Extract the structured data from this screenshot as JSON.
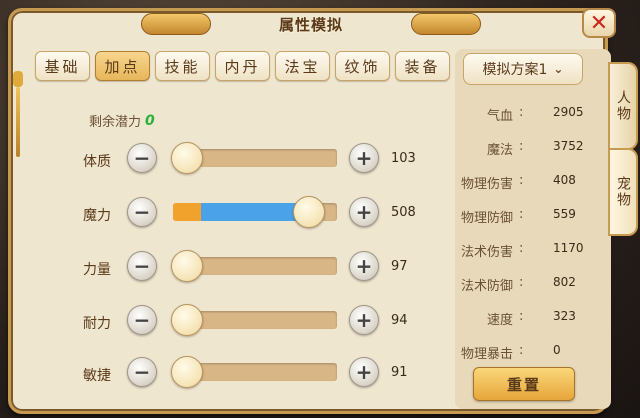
{
  "window": {
    "title": "属性模拟",
    "close_icon": "close-icon"
  },
  "tabs": [
    {
      "label": "基础",
      "active": false
    },
    {
      "label": "加点",
      "active": true
    },
    {
      "label": "技能",
      "active": false
    },
    {
      "label": "内丹",
      "active": false
    },
    {
      "label": "法宝",
      "active": false
    },
    {
      "label": "纹饰",
      "active": false
    },
    {
      "label": "装备",
      "active": false
    }
  ],
  "potential": {
    "label": "剩余潜力",
    "value": "0"
  },
  "attributes": [
    {
      "label": "体质",
      "value": "103",
      "fill_fraction": 0.0
    },
    {
      "label": "魔力",
      "value": "508",
      "fill_fraction": 0.83
    },
    {
      "label": "力量",
      "value": "97",
      "fill_fraction": 0.0
    },
    {
      "label": "耐力",
      "value": "94",
      "fill_fraction": 0.0
    },
    {
      "label": "敏捷",
      "value": "91",
      "fill_fraction": 0.0
    }
  ],
  "scheme": {
    "selected": "模拟方案1",
    "icon": "chevron-down-icon"
  },
  "stats": [
    {
      "name": "气血",
      "value": "2905"
    },
    {
      "name": "魔法",
      "value": "3752"
    },
    {
      "name": "物理伤害",
      "value": "408"
    },
    {
      "name": "物理防御",
      "value": "559"
    },
    {
      "name": "法术伤害",
      "value": "1170"
    },
    {
      "name": "法术防御",
      "value": "802"
    },
    {
      "name": "速度",
      "value": "323"
    },
    {
      "name": "物理暴击",
      "value": "0"
    }
  ],
  "reset_label": "重置",
  "side_tabs": [
    {
      "label": "人物"
    },
    {
      "label": "宠物"
    }
  ],
  "colors": {
    "panel_bg": "#efe6cf",
    "border_gold": "#c79a52",
    "active_tab": "#e7b659",
    "slider_orange": "#f0a22c",
    "slider_blue": "#4aa3e8",
    "potential_green": "#2db03a",
    "close_red": "#c8281e"
  }
}
